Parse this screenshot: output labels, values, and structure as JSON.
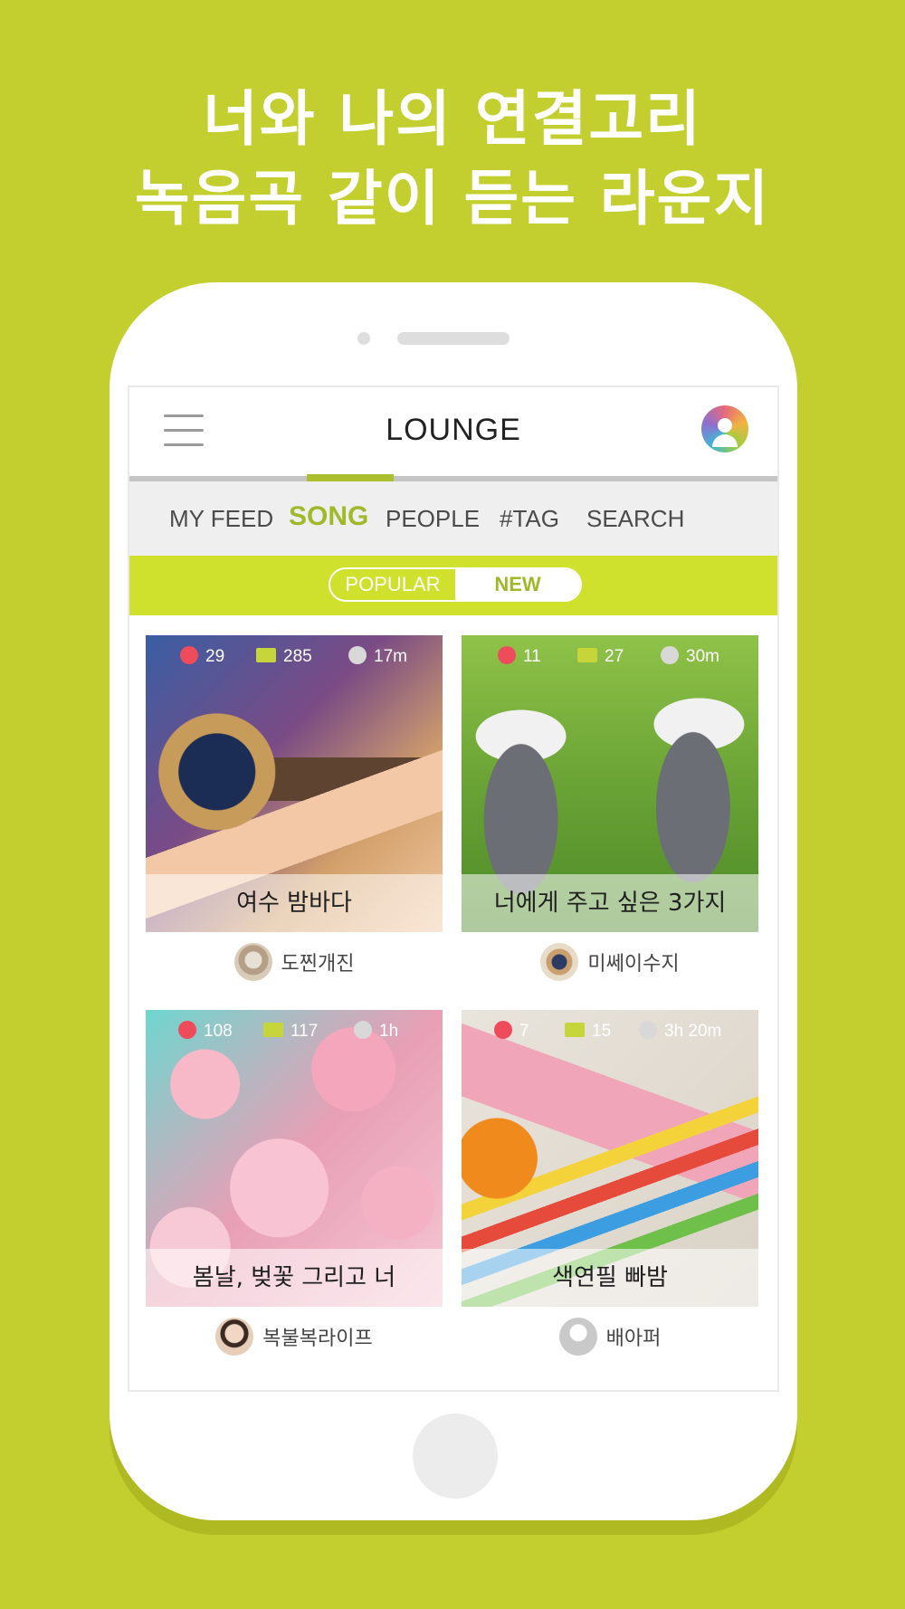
{
  "headline": {
    "line1": "너와 나의 연결고리",
    "line2": "녹음곡 같이 듣는 라운지"
  },
  "app": {
    "title": "LOUNGE",
    "menu_icon": "hamburger-icon",
    "profile_icon": "profile-icon"
  },
  "tabs": [
    {
      "label": "MY FEED",
      "active": false
    },
    {
      "label": "SONG",
      "active": true
    },
    {
      "label": "PEOPLE",
      "active": false
    },
    {
      "label": "#TAG",
      "active": false
    },
    {
      "label": "SEARCH",
      "active": false
    }
  ],
  "sort": {
    "popular": "POPULAR",
    "new": "NEW",
    "selected": "NEW"
  },
  "cards": [
    {
      "likes": "29",
      "comments": "285",
      "time": "17m",
      "title": "여수 밤바다",
      "author": "도찐개진"
    },
    {
      "likes": "11",
      "comments": "27",
      "time": "30m",
      "title": "너에게 주고 싶은 3가지",
      "author": "미쎄이수지"
    },
    {
      "likes": "108",
      "comments": "117",
      "time": "1h",
      "title": "봄날, 벚꽃 그리고 너",
      "author": "복불복라이프"
    },
    {
      "likes": "7",
      "comments": "15",
      "time": "3h 20m",
      "title": "색연필 빠밤",
      "author": "배아퍼"
    }
  ],
  "colors": {
    "background": "#c3cf2f",
    "accent": "#9fb92a",
    "sortbar": "#cfe02d",
    "like": "#ef4c5b",
    "comment": "#c5d53a"
  }
}
